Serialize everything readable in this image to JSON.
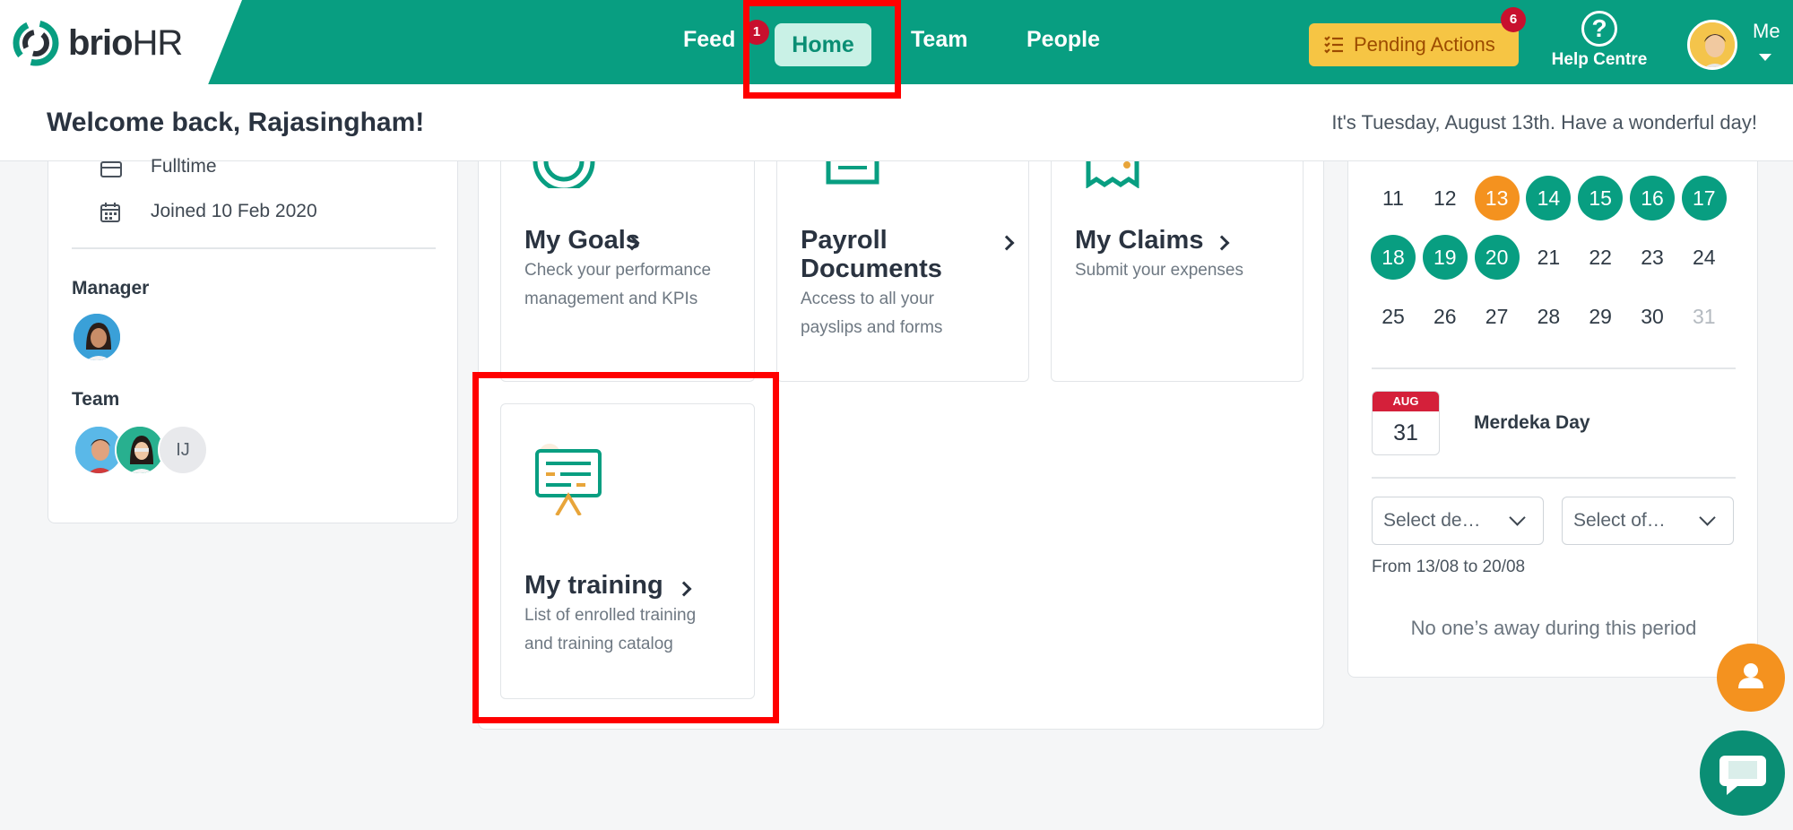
{
  "brand": {
    "name_part1": "brio",
    "name_part2": "HR",
    "accent": "#089e81"
  },
  "nav": {
    "items": [
      {
        "label": "Feed"
      },
      {
        "label": "Home",
        "active": true,
        "badge": "1"
      },
      {
        "label": "Team"
      },
      {
        "label": "People"
      }
    ]
  },
  "actions": {
    "pending_label": "Pending Actions",
    "pending_count": "6",
    "help_label": "Help Centre",
    "me_label": "Me"
  },
  "header": {
    "welcome": "Welcome back, Rajasingham!",
    "greeting": "It's Tuesday, August 13th. Have a wonderful day!"
  },
  "profile": {
    "employment_type": "Fulltime",
    "joined": "Joined 10 Feb 2020",
    "manager_title": "Manager",
    "team_title": "Team",
    "team_initials": "IJ"
  },
  "tiles": {
    "goals": {
      "title": "My Goals",
      "desc1": "Check your performance",
      "desc2": "management and KPIs"
    },
    "payroll": {
      "title1": "Payroll",
      "title2": "Documents",
      "desc1": "Access to all your",
      "desc2": "payslips and forms"
    },
    "claims": {
      "title": "My Claims",
      "desc1": "Submit your expenses"
    },
    "training": {
      "title": "My training",
      "desc1": "List of enrolled training",
      "desc2": "and training catalog"
    }
  },
  "calendar": {
    "weeks": [
      [
        "11",
        "12",
        "13",
        "14",
        "15",
        "16",
        "17"
      ],
      [
        "18",
        "19",
        "20",
        "21",
        "22",
        "23",
        "24"
      ],
      [
        "25",
        "26",
        "27",
        "28",
        "29",
        "30",
        "31"
      ]
    ],
    "today": "13",
    "selected": [
      "14",
      "15",
      "16",
      "17",
      "18",
      "19",
      "20"
    ],
    "dimmed": [
      "31"
    ],
    "holiday": {
      "month": "AUG",
      "day": "31",
      "name": "Merdeka Day"
    },
    "select_department": "Select de…",
    "select_office": "Select of…",
    "range": "From 13/08 to 20/08",
    "empty_message": "No one’s away during this period"
  }
}
